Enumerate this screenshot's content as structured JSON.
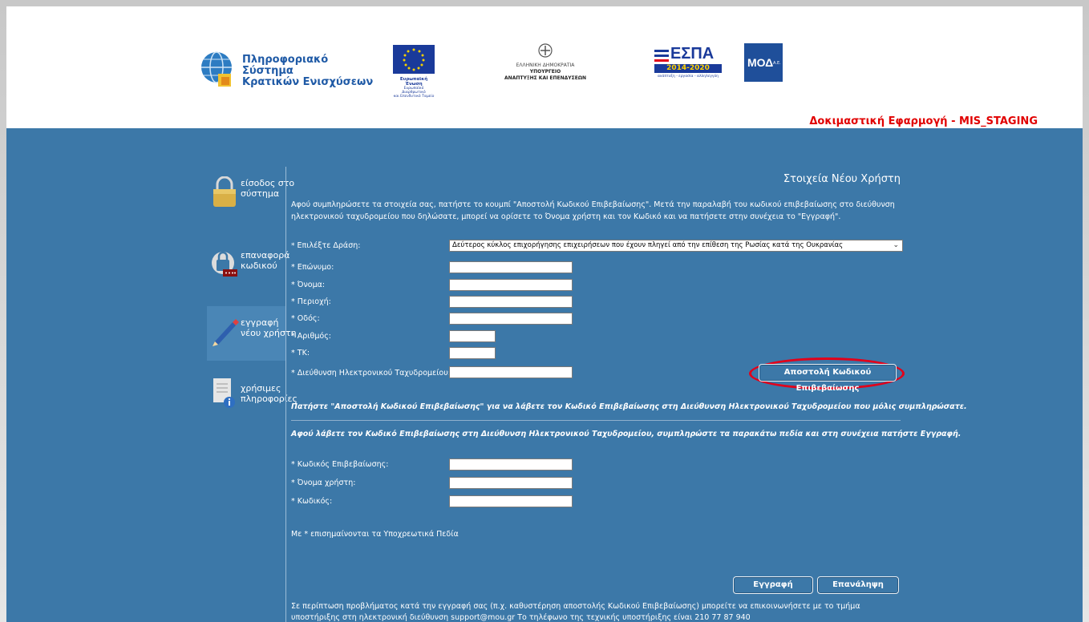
{
  "header": {
    "logo_title_line1": "Πληροφοριακό Σύστημα",
    "logo_title_line2": "Κρατικών Ενισχύσεων",
    "eu_caption": "Ευρωπαϊκή Ένωση",
    "eu_sub1": "Ευρωπαϊκό Διαρθρωτικό",
    "eu_sub2": "και Επενδυτικό Ταμείο",
    "gov_line1": "ΕΛΛΗΝΙΚΗ ΔΗΜΟΚΡΑΤΙΑ",
    "gov_line2": "ΥΠΟΥΡΓΕΙΟ",
    "gov_line3": "ΑΝΑΠΤΥΞΗΣ ΚΑΙ ΕΠΕΝΔΥΣΕΩΝ",
    "espa_title": "ΕΣΠΑ",
    "espa_years": "2014-2020",
    "espa_tag": "ανάπτυξη - εργασία - αλληλεγγύη",
    "mod_title": "ΜΟΔ",
    "mod_suffix": "Α.Ε.",
    "staging_label": "Δοκιμαστική Εφαρμογή - MIS_STAGING"
  },
  "sidebar": {
    "items": [
      {
        "label": "είσοδος στο σύστημα"
      },
      {
        "label": "επαναφορά κωδικού"
      },
      {
        "label": "εγγραφή νέου χρήστη"
      },
      {
        "label": "χρήσιμες πληροφορίες"
      }
    ]
  },
  "form": {
    "title": "Στοιχεία Νέου Χρήστη",
    "intro": "Αφού συμπληρώσετε τα στοιχεία σας, πατήστε το κουμπί \"Αποστολή Κωδικού Επιβεβαίωσης\". Μετά την παραλαβή του κωδικού επιβεβαίωσης στο διεύθυνση ηλεκτρονικού ταχυδρομείου που δηλώσατε, μπορεί να ορίσετε το Όνομα χρήστη και τον Κωδικό και να πατήσετε στην συνέχεια το \"Εγγραφή\".",
    "action_label": "Επιλέξτε Δράση:",
    "action_value": "Δεύτερος κύκλος επιχορήγησης επιχειρήσεων που έχουν πληγεί από την επίθεση της Ρωσίας κατά της Ουκρανίας",
    "fields": {
      "surname": "Επώνυμο:",
      "name": "Όνομα:",
      "region": "Περιοχή:",
      "street": "Οδός:",
      "number": "Αριθμός:",
      "zip": "ΤΚ:",
      "email": "Διεύθυνση Ηλεκτρονικού Ταχυδρομείου:"
    },
    "send_code_button": "Αποστολή Κωδικού Επιβεβαίωσης",
    "note_send": "Πατήστε \"Αποστολή Κωδικού Επιβεβαίωσης\" για να λάβετε τον Κωδικό Επιβεβαίωσης στη Διεύθυνση Ηλεκτρονικού Ταχυδρομείου που μόλις συμπληρώσατε.",
    "note_after": "Αφού λάβετε τον Κωδικό Επιβεβαίωσης στη Διεύθυνση Ηλεκτρονικού Ταχυδρομείου, συμπληρώστε τα παρακάτω πεδία και στη συνέχεια πατήστε Εγγραφή.",
    "fields2": {
      "code": "Κωδικός Επιβεβαίωσης:",
      "username": "Όνομα χρήστη:",
      "password": "Κωδικός:"
    },
    "required_note": "Με * επισημαίνονται τα Υποχρεωτικά Πεδία",
    "register_button": "Εγγραφή",
    "reset_button": "Επανάληψη",
    "footer": "Σε περίπτωση προβλήματος κατά την εγγραφή σας (π.χ. καθυστέρηση αποστολής Κωδικού Επιβεβαίωσης) μπορείτε να επικοινωνήσετε με το τμήμα υποστήριξης στη ηλεκτρονική διεύθυνση support@mou.gr Το τηλέφωνο της τεχνικής υποστήριξης είναι 210 77 87 940"
  },
  "colors": {
    "background": "#3c78a8",
    "staging": "#e10000",
    "highlight": "#e2001a"
  }
}
